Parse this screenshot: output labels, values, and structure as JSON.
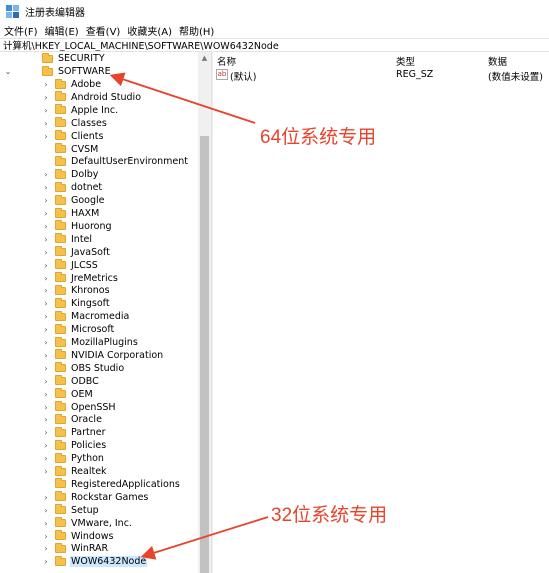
{
  "window": {
    "title": "注册表编辑器"
  },
  "menu": [
    "文件(F)",
    "编辑(E)",
    "查看(V)",
    "收藏夹(A)",
    "帮助(H)"
  ],
  "address": "计算机\\HKEY_LOCAL_MACHINE\\SOFTWARE\\WOW6432Node",
  "tree": {
    "top_items": [
      {
        "label": "SECURITY",
        "expanded": false
      },
      {
        "label": "SOFTWARE",
        "expanded": true
      }
    ],
    "children": [
      "Adobe",
      "Android Studio",
      "Apple Inc.",
      "Classes",
      "Clients",
      "CVSM",
      "DefaultUserEnvironment",
      "Dolby",
      "dotnet",
      "Google",
      "HAXM",
      "Huorong",
      "Intel",
      "JavaSoft",
      "JLCSS",
      "JreMetrics",
      "Khronos",
      "Kingsoft",
      "Macromedia",
      "Microsoft",
      "MozillaPlugins",
      "NVIDIA Corporation",
      "OBS Studio",
      "ODBC",
      "OEM",
      "OpenSSH",
      "Oracle",
      "Partner",
      "Policies",
      "Python",
      "Realtek",
      "RegisteredApplications",
      "Rockstar Games",
      "Setup",
      "VMware, Inc.",
      "Windows",
      "WinRAR",
      "WOW6432Node"
    ],
    "selected": "WOW6432Node",
    "no_expander": [
      "CVSM",
      "DefaultUserEnvironment",
      "RegisteredApplications"
    ]
  },
  "values": {
    "headers": {
      "name": "名称",
      "type": "类型",
      "data": "数据"
    },
    "rows": [
      {
        "name": "(默认)",
        "type": "REG_SZ",
        "data": "(数值未设置)",
        "icon": "ab-string-icon"
      }
    ]
  },
  "annotations": {
    "label_64": "64位系统专用",
    "label_32": "32位系统专用",
    "color": "#e8442c"
  }
}
